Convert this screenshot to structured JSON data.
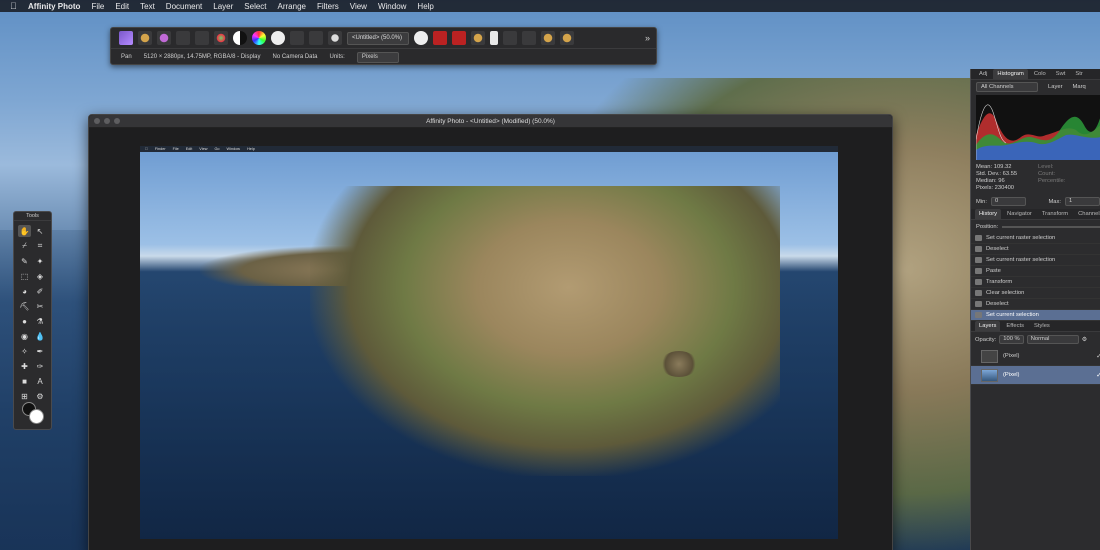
{
  "menubar": {
    "app_name": "Affinity Photo",
    "items": [
      "File",
      "Edit",
      "Text",
      "Document",
      "Layer",
      "Select",
      "Arrange",
      "Filters",
      "View",
      "Window",
      "Help"
    ]
  },
  "toolbar": {
    "doc_select": "<Untitled> (50.0%)",
    "status_tool": "Pan",
    "status_dims": "5120 × 2880px, 14.75MP, RGBA/8 - Display",
    "status_camera": "No Camera Data",
    "units_label": "Units:",
    "units_value": "Pixels"
  },
  "document_window": {
    "title": "Affinity Photo - <Untitled> (Modified) (50.0%)",
    "image_menubar": [
      "Finder",
      "File",
      "Edit",
      "View",
      "Go",
      "Window",
      "Help"
    ]
  },
  "tools": {
    "title": "Tools"
  },
  "studio": {
    "top_tabs": [
      "Adj",
      "Histogram",
      "Colo",
      "Swt",
      "Str"
    ],
    "channels_select": "All Channels",
    "layer_label": "Layer",
    "marquee_label": "Marq",
    "stats": {
      "mean": "Mean: 109.32",
      "stddev": "Std. Dev.: 63.55",
      "median": "Median: 96",
      "pixels": "Pixels: 230400",
      "level": "Level:",
      "count": "Count:",
      "percentile": "Percentile:"
    },
    "min_label": "Min:",
    "min_value": "0",
    "max_label": "Max:",
    "max_value": "1",
    "mid_tabs": [
      "History",
      "Navigator",
      "Transform",
      "Channels"
    ],
    "position_label": "Position:",
    "history": [
      "Set current raster selection",
      "Deselect",
      "Set current raster selection",
      "Paste",
      "Transform",
      "Clear selection",
      "Deselect",
      "Set current selection"
    ],
    "layer_tabs": [
      "Layers",
      "Effects",
      "Styles"
    ],
    "opacity_label": "Opacity:",
    "opacity_value": "100 %",
    "blend_mode": "Normal",
    "layers": [
      "(Pixel)",
      "(Pixel)"
    ]
  }
}
